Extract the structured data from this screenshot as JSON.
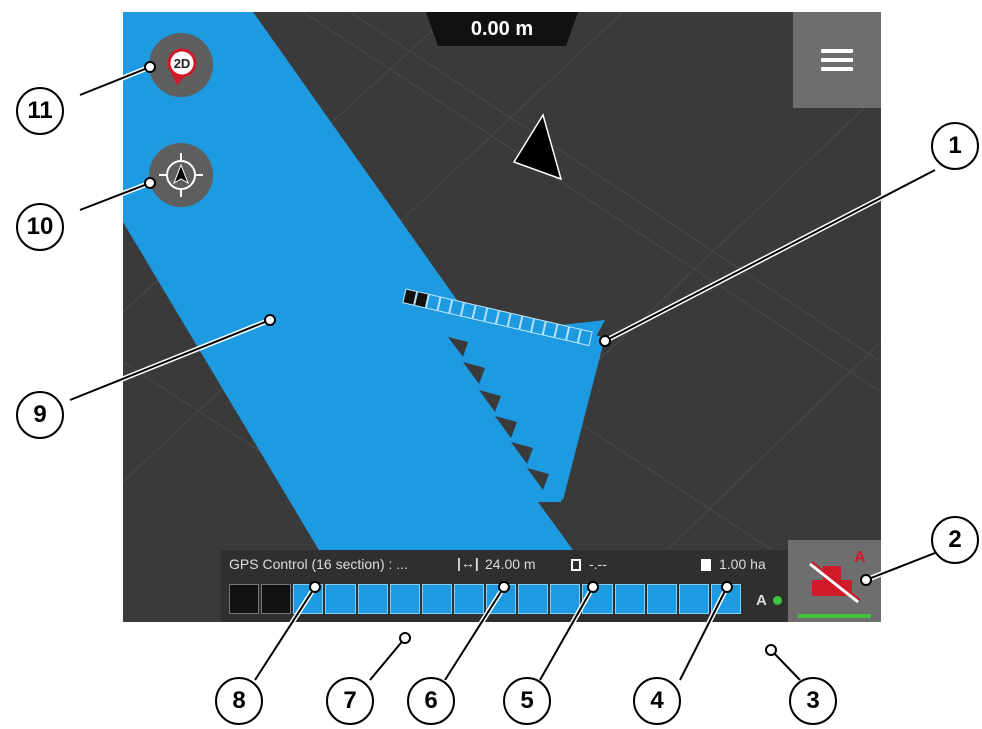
{
  "header": {
    "distance": "0.00 m"
  },
  "status_bar": {
    "mode_name": "GPS Control (16 section) : ...",
    "working_width": "24.00 m",
    "remaining_area": "-.--",
    "worked_area": "1.00 ha",
    "mode_letter": "A",
    "sections_total": 16,
    "sections_off": 2
  },
  "boom": {
    "sections_total": 16,
    "sections_off": 2
  },
  "round_buttons": {
    "view_mode_label": "2D"
  },
  "colors": {
    "worked_area": "#1e9be0",
    "field": "#3a3a3a",
    "status_ok": "#3ec43e",
    "alert": "#d01a2a"
  },
  "callouts": [
    "1",
    "2",
    "3",
    "4",
    "5",
    "6",
    "7",
    "8",
    "9",
    "10",
    "11"
  ]
}
